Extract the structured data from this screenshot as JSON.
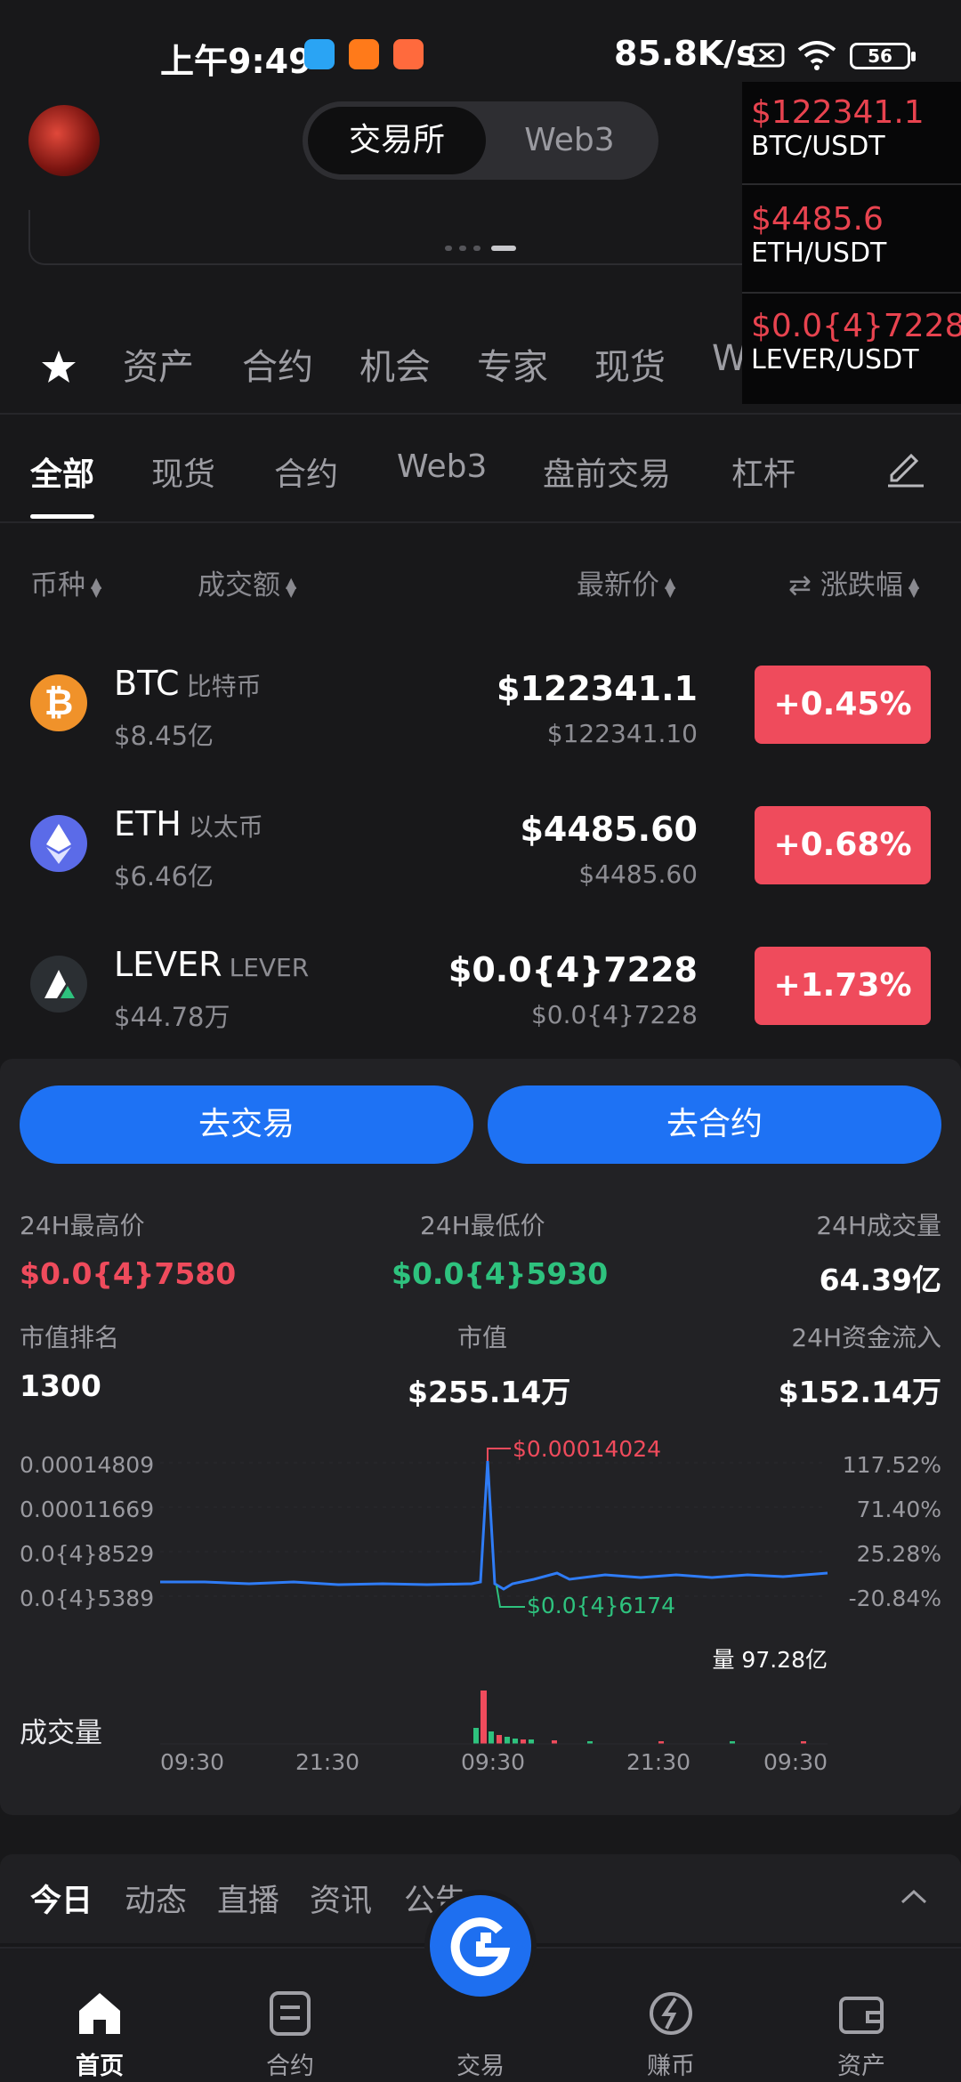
{
  "status_bar": {
    "time": "上午9:49",
    "network_speed": "85.8K/s",
    "battery": "56"
  },
  "header": {
    "segment_exchange": "交易所",
    "segment_web3": "Web3"
  },
  "ticker": [
    {
      "price": "$122341.1",
      "pair": "BTC/USDT"
    },
    {
      "price": "$4485.6",
      "pair": "ETH/USDT"
    },
    {
      "price": "$0.0{4}7228",
      "pair": "LEVER/USDT"
    }
  ],
  "categories": [
    "资产",
    "合约",
    "机会",
    "专家",
    "现货",
    "Web3"
  ],
  "sub_tabs": [
    "全部",
    "现货",
    "合约",
    "Web3",
    "盘前交易",
    "杠杆"
  ],
  "columns": {
    "coin": "币种",
    "volume": "成交额",
    "price": "最新价",
    "change": "涨跌幅"
  },
  "coins": [
    {
      "symbol": "BTC",
      "name": "比特币",
      "volume": "$8.45亿",
      "price": "$122341.1",
      "price_sub": "$122341.10",
      "change": "+0.45%"
    },
    {
      "symbol": "ETH",
      "name": "以太币",
      "volume": "$6.46亿",
      "price": "$4485.60",
      "price_sub": "$4485.60",
      "change": "+0.68%"
    },
    {
      "symbol": "LEVER",
      "name": "LEVER",
      "volume": "$44.78万",
      "price": "$0.0{4}7228",
      "price_sub": "$0.0{4}7228",
      "change": "+1.73%"
    }
  ],
  "actions": {
    "trade": "去交易",
    "contract": "去合约"
  },
  "stats": {
    "high_label": "24H最高价",
    "high_value": "$0.0{4}7580",
    "low_label": "24H最低价",
    "low_value": "$0.0{4}5930",
    "vol_label": "24H成交量",
    "vol_value": "64.39亿",
    "rank_label": "市值排名",
    "rank_value": "1300",
    "cap_label": "市值",
    "cap_value": "$255.14万",
    "flow_label": "24H资金流入",
    "flow_value": "$152.14万"
  },
  "chart": {
    "y_left": [
      "0.00014809",
      "0.00011669",
      "0.0{4}8529",
      "0.0{4}5389"
    ],
    "y_right": [
      "117.52%",
      "71.40%",
      "25.28%",
      "-20.84%"
    ],
    "peak_label": "$0.00014024",
    "low_label": "$0.0{4}6174",
    "volume_badge": "量 97.28亿",
    "volume_title": "成交量",
    "x_ticks": [
      "09:30",
      "21:30",
      "09:30",
      "21:30",
      "09:30"
    ],
    "colors": {
      "line": "#2f7cf6",
      "up": "#ef4b5c",
      "down": "#2ec27e"
    }
  },
  "news_tabs": [
    "今日",
    "动态",
    "直播",
    "资讯",
    "公告"
  ],
  "nav": [
    "首页",
    "合约",
    "交易",
    "赚币",
    "资产"
  ]
}
